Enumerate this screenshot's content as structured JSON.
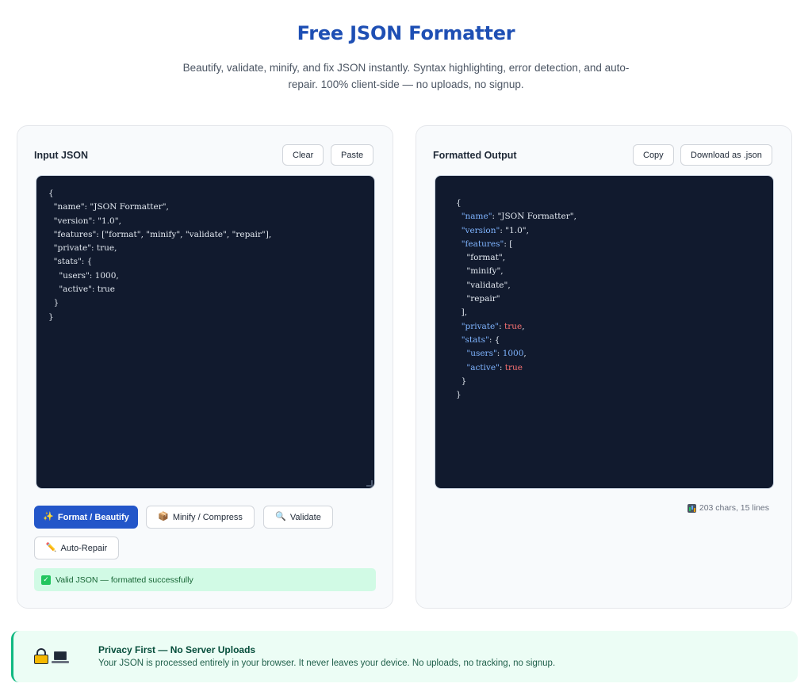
{
  "header": {
    "title": "Free JSON Formatter",
    "subtitle": "Beautify, validate, minify, and fix JSON instantly. Syntax highlighting, error detection, and auto-repair. 100% client-side — no uploads, no signup."
  },
  "input_panel": {
    "title": "Input JSON",
    "clear_label": "Clear",
    "paste_label": "Paste",
    "value": "{\n  \"name\": \"JSON Formatter\",\n  \"version\": \"1.0\",\n  \"features\": [\"format\", \"minify\", \"validate\", \"repair\"],\n  \"private\": true,\n  \"stats\": {\n    \"users\": 1000,\n    \"active\": true\n  }\n}"
  },
  "output_panel": {
    "title": "Formatted Output",
    "copy_label": "Copy",
    "download_label": "Download as .json",
    "stats": "203 chars, 15 lines",
    "lines": [
      [
        {
          "t": "p",
          "v": "{"
        }
      ],
      [
        {
          "t": "p",
          "v": "  "
        },
        {
          "t": "k",
          "v": "\"name\""
        },
        {
          "t": "p",
          "v": ": "
        },
        {
          "t": "s",
          "v": "\"JSON Formatter\""
        },
        {
          "t": "p",
          "v": ","
        }
      ],
      [
        {
          "t": "p",
          "v": "  "
        },
        {
          "t": "k",
          "v": "\"version\""
        },
        {
          "t": "p",
          "v": ": "
        },
        {
          "t": "s",
          "v": "\"1.0\""
        },
        {
          "t": "p",
          "v": ","
        }
      ],
      [
        {
          "t": "p",
          "v": "  "
        },
        {
          "t": "k",
          "v": "\"features\""
        },
        {
          "t": "p",
          "v": ": ["
        }
      ],
      [
        {
          "t": "p",
          "v": "    "
        },
        {
          "t": "s",
          "v": "\"format\""
        },
        {
          "t": "p",
          "v": ","
        }
      ],
      [
        {
          "t": "p",
          "v": "    "
        },
        {
          "t": "s",
          "v": "\"minify\""
        },
        {
          "t": "p",
          "v": ","
        }
      ],
      [
        {
          "t": "p",
          "v": "    "
        },
        {
          "t": "s",
          "v": "\"validate\""
        },
        {
          "t": "p",
          "v": ","
        }
      ],
      [
        {
          "t": "p",
          "v": "    "
        },
        {
          "t": "s",
          "v": "\"repair\""
        }
      ],
      [
        {
          "t": "p",
          "v": "  ],"
        }
      ],
      [
        {
          "t": "p",
          "v": "  "
        },
        {
          "t": "k",
          "v": "\"private\""
        },
        {
          "t": "p",
          "v": ": "
        },
        {
          "t": "b",
          "v": "true"
        },
        {
          "t": "p",
          "v": ","
        }
      ],
      [
        {
          "t": "p",
          "v": "  "
        },
        {
          "t": "k",
          "v": "\"stats\""
        },
        {
          "t": "p",
          "v": ": {"
        }
      ],
      [
        {
          "t": "p",
          "v": "    "
        },
        {
          "t": "k",
          "v": "\"users\""
        },
        {
          "t": "p",
          "v": ": "
        },
        {
          "t": "n",
          "v": "1000"
        },
        {
          "t": "p",
          "v": ","
        }
      ],
      [
        {
          "t": "p",
          "v": "    "
        },
        {
          "t": "k",
          "v": "\"active\""
        },
        {
          "t": "p",
          "v": ": "
        },
        {
          "t": "b",
          "v": "true"
        }
      ],
      [
        {
          "t": "p",
          "v": "  }"
        }
      ],
      [
        {
          "t": "p",
          "v": "}"
        }
      ]
    ]
  },
  "actions": {
    "format_label": "Format / Beautify",
    "format_icon": "sparkles-icon",
    "minify_label": "Minify / Compress",
    "minify_icon": "package-icon",
    "validate_label": "Validate",
    "validate_icon": "magnifier-icon",
    "repair_label": "Auto-Repair",
    "repair_icon": "pencil-icon"
  },
  "status": {
    "message": "Valid JSON — formatted successfully"
  },
  "privacy": {
    "title": "Privacy First — No Server Uploads",
    "text": "Your JSON is processed entirely in your browser. It never leaves your device. No uploads, no tracking, no signup."
  },
  "colors": {
    "brand": "#1e4fb4",
    "primary_button": "#2356c9",
    "editor_bg": "#111a2e",
    "success_bg": "#d1fae5",
    "privacy_accent": "#10b981"
  }
}
